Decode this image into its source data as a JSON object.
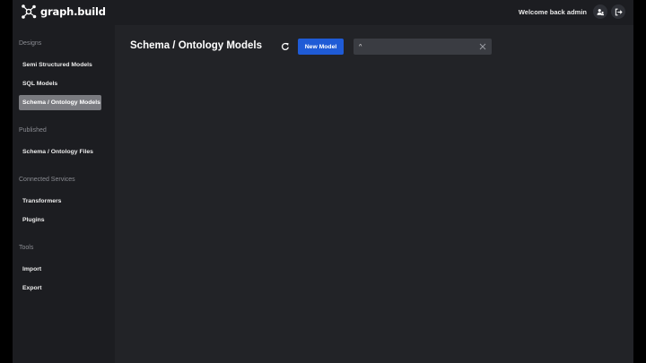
{
  "app": {
    "name": "graph.build",
    "logo_icon": "graph-nodes-icon"
  },
  "header": {
    "welcome": "Welcome back admin",
    "users_icon": "users-icon",
    "logout_icon": "logout-icon"
  },
  "sidebar": {
    "sections": [
      {
        "label": "Designs",
        "items": [
          {
            "label": "Semi Structured Models"
          },
          {
            "label": "SQL Models"
          },
          {
            "label": "Schema / Ontology Models",
            "active": true
          }
        ]
      },
      {
        "label": "Published",
        "items": [
          {
            "label": "Schema / Ontology Files"
          }
        ]
      },
      {
        "label": "Connected Services",
        "items": [
          {
            "label": "Transformers"
          },
          {
            "label": "Plugins"
          }
        ]
      },
      {
        "label": "Tools",
        "items": [
          {
            "label": "Import"
          },
          {
            "label": "Export"
          }
        ]
      }
    ]
  },
  "main": {
    "title": "Schema / Ontology Models",
    "refresh_icon": "refresh-icon",
    "new_model_label": "New Model",
    "search": {
      "value": "^",
      "clear_icon": "close-icon"
    }
  },
  "colors": {
    "background": "#1c1d21",
    "content": "#222327",
    "accent": "#1f5bd6",
    "active_nav": "#7a7b80",
    "search_bg": "#3a3c42"
  }
}
